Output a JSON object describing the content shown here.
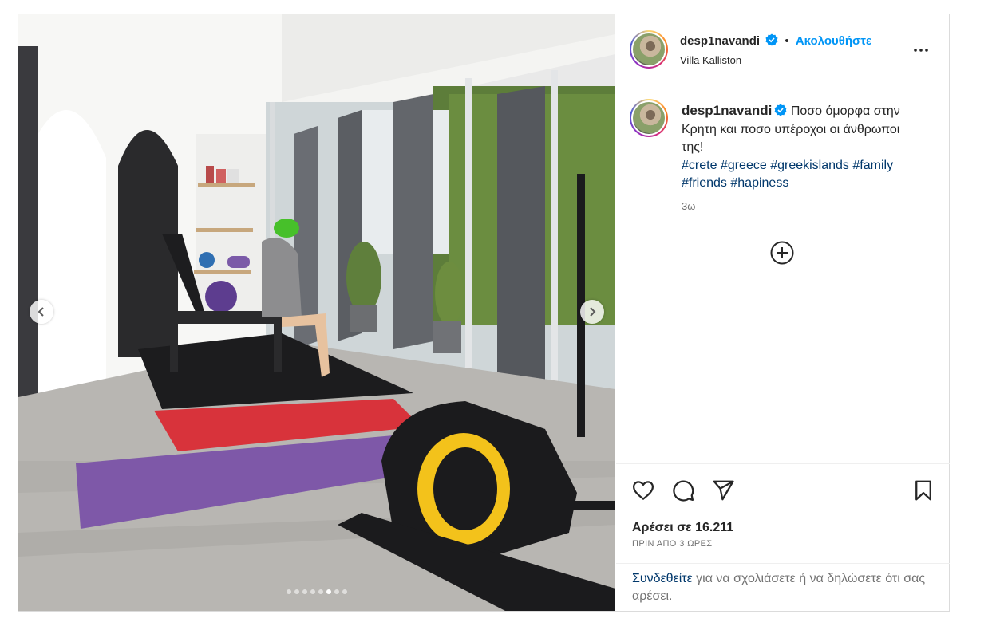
{
  "post": {
    "username": "desp1navandi",
    "verified": true,
    "location": "Villa Kalliston",
    "follow_label": "Ακολουθήστε",
    "separator": "•"
  },
  "caption": {
    "username": "desp1navandi",
    "text": "Ποσο όμορφα στην Κρητη και ποσο υπέροχοι οι άνθρωποι της!",
    "hashtags": [
      "#crete",
      "#greece",
      "#greekislands",
      "#family",
      "#friends",
      "#hapiness"
    ],
    "age": "3ω"
  },
  "carousel": {
    "total": 8,
    "active_index": 5
  },
  "engagement": {
    "likes_label": "Αρέσει σε 16.211",
    "posted": "ΠΡΙΝ ΑΠΟ 3 ΩΡΕΣ"
  },
  "comment_prompt": {
    "link": "Συνδεθείτε",
    "rest": " για να σχολιάσετε ή να δηλώσετε ότι σας αρέσει."
  },
  "icons": {
    "verified": "verified-badge-icon",
    "more": "more-options-icon",
    "add": "add-circle-icon",
    "like": "heart-icon",
    "comment": "comment-icon",
    "share": "send-icon",
    "save": "bookmark-icon",
    "prev": "chevron-left-icon",
    "next": "chevron-right-icon"
  },
  "colors": {
    "accent": "#0095f6",
    "hashtag": "#00376b",
    "verified": "#0095f6",
    "muted": "#737373"
  }
}
